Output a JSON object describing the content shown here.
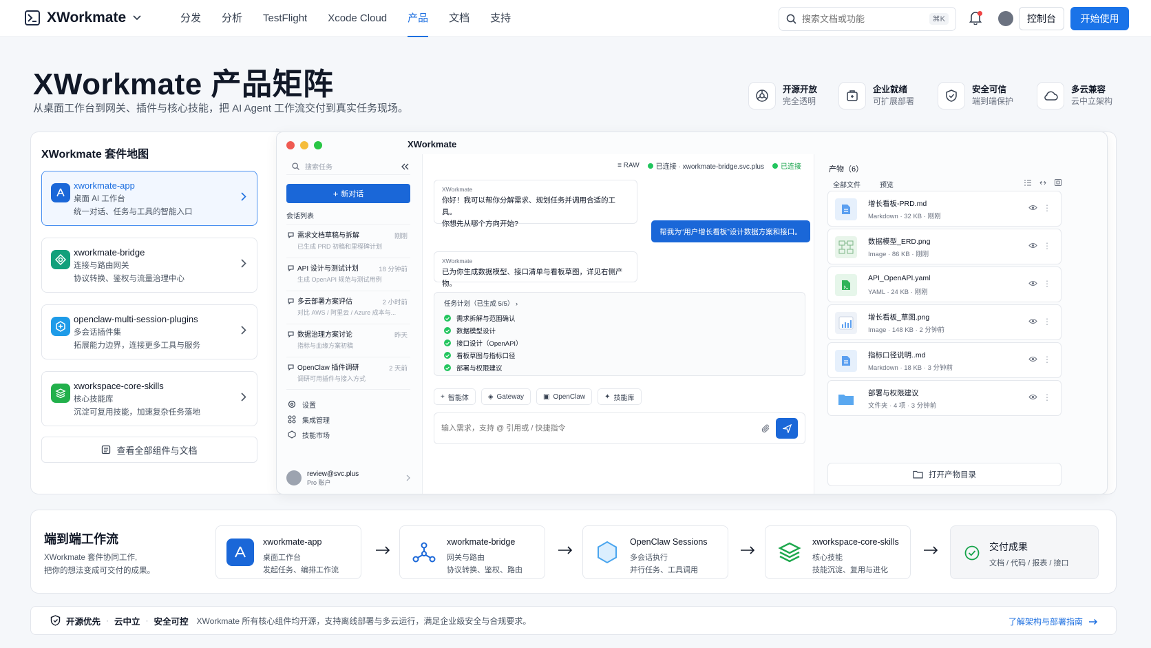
{
  "nav": {
    "brand": "XWorkmate",
    "links": [
      "分发",
      "分析",
      "TestFlight",
      "Xcode Cloud",
      "产品",
      "文档",
      "支持"
    ],
    "active_link": "产品",
    "search_placeholder": "搜索文档或功能",
    "search_kbd": "⌘K",
    "console_label": "控制台",
    "start_label": "开始使用"
  },
  "hero": {
    "title": "XWorkmate 产品矩阵",
    "subtitle": "从桌面工作台到网关、插件与核心技能，把 AI Agent 工作流交付到真实任务现场。",
    "features": [
      {
        "title": "开源开放",
        "desc": "完全透明",
        "icon": "open-source-icon"
      },
      {
        "title": "企业就绪",
        "desc": "可扩展部署",
        "icon": "enterprise-icon"
      },
      {
        "title": "安全可信",
        "desc": "端到端保护",
        "icon": "shield-icon"
      },
      {
        "title": "多云兼容",
        "desc": "云中立架构",
        "icon": "cloud-icon"
      }
    ]
  },
  "suite_map": {
    "title": "XWorkmate 套件地图",
    "components": [
      {
        "name": "xworkmate-app",
        "subtitle": "桌面 AI 工作台",
        "desc": "统一对话、任务与工具的智能入口",
        "color": "#1a67d8"
      },
      {
        "name": "xworkmate-bridge",
        "subtitle": "连接与路由网关",
        "desc": "协议转换、鉴权与流量治理中心",
        "color": "#12a07b"
      },
      {
        "name": "openclaw-multi-session-plugins",
        "subtitle": "多会话插件集",
        "desc": "拓展能力边界，连接更多工具与服务",
        "color": "#1e9be8"
      },
      {
        "name": "xworkspace-core-skills",
        "subtitle": "核心技能库",
        "desc": "沉淀可复用技能，加速复杂任务落地",
        "color": "#22b04b"
      }
    ],
    "all_button": "查看全部组件与文档"
  },
  "app_window": {
    "title": "XWorkmate",
    "sidebar": {
      "search_placeholder": "搜索任务",
      "new_chat": "新对话",
      "list_label": "会话列表",
      "conversations": [
        {
          "title": "需求文档草稿与拆解",
          "time": "刚刚",
          "desc": "已生成 PRD 初稿和里程碑计划"
        },
        {
          "title": "API 设计与测试计划",
          "time": "18 分钟前",
          "desc": "生成 OpenAPI 规范与测试用例"
        },
        {
          "title": "多云部署方案评估",
          "time": "2 小时前",
          "desc": "对比 AWS / 阿里云 / Azure 成本与..."
        },
        {
          "title": "数据治理方案讨论",
          "time": "昨天",
          "desc": "指标与血缘方案初稿"
        },
        {
          "title": "OpenClaw 插件调研",
          "time": "2 天前",
          "desc": "调研可用插件与接入方式"
        }
      ],
      "nav_items": [
        "设置",
        "集成管理",
        "技能市场"
      ],
      "account_email": "review@svc.plus",
      "account_plan": "Pro 账户"
    },
    "chat": {
      "raw_label": "RAW",
      "connection": "已连接 · xworkmate-bridge.svc.plus",
      "connected": "已连接",
      "msg1_sender": "XWorkmate",
      "msg1_line1": "你好！我可以帮你分解需求、规划任务并调用合适的工具。",
      "msg1_line2": "你想先从哪个方向开始?",
      "user_msg": "帮我为“用户增长看板”设计数据方案和接口。",
      "msg2_sender": "XWorkmate",
      "msg2_text": "已为你生成数据模型、接口清单与看板草图，详见右侧产物。",
      "plan_header": "任务计划（已生成 5/5）",
      "plan_items": [
        "需求拆解与范围确认",
        "数据模型设计",
        "接口设计（OpenAPI）",
        "看板草图与指标口径",
        "部署与权限建议"
      ],
      "chips": [
        "智能体",
        "Gateway",
        "OpenClaw",
        "技能库"
      ],
      "input_placeholder": "输入需求，支持 @ 引用或 / 快捷指令"
    },
    "artifacts": {
      "header": "产物（6）",
      "tabs": [
        "全部文件",
        "预览"
      ],
      "files": [
        {
          "name": "增长看板-PRD.md",
          "meta": "Markdown · 32 KB · 刚刚",
          "icon": "doc-file-icon"
        },
        {
          "name": "数据模型_ERD.png",
          "meta": "Image · 86 KB · 刚刚",
          "icon": "image-file-icon"
        },
        {
          "name": "API_OpenAPI.yaml",
          "meta": "YAML · 24 KB · 刚刚",
          "icon": "yaml-file-icon"
        },
        {
          "name": "增长看板_草图.png",
          "meta": "Image · 148 KB · 2 分钟前",
          "icon": "chart-file-icon"
        },
        {
          "name": "指标口径说明..md",
          "meta": "Markdown · 18 KB · 3 分钟前",
          "icon": "doc-file-icon"
        },
        {
          "name": "部署与权限建议",
          "meta": "文件夹 · 4 项 · 3 分钟前",
          "icon": "folder-icon"
        }
      ],
      "open_dir": "打开产物目录"
    }
  },
  "workflow": {
    "title": "端到端工作流",
    "desc_line1": "XWorkmate 套件协同工作,",
    "desc_line2": "把你的想法变成可交付的成果。",
    "steps": [
      {
        "name": "xworkmate-app",
        "subtitle": "桌面工作台",
        "desc": "发起任务、编排工作流"
      },
      {
        "name": "xworkmate-bridge",
        "subtitle": "网关与路由",
        "desc": "协议转换、鉴权、路由"
      },
      {
        "name": "OpenClaw Sessions",
        "subtitle": "多会话执行",
        "desc": "并行任务、工具调用"
      },
      {
        "name": "xworkspace-core-skills",
        "subtitle": "核心技能",
        "desc": "技能沉淀、复用与进化"
      }
    ],
    "deliver_title": "交付成果",
    "deliver_desc": "文档 / 代码 / 报表 / 接口"
  },
  "footer": {
    "tag1": "开源优先",
    "tag2": "云中立",
    "tag3": "安全可控",
    "desc": "XWorkmate 所有核心组件均开源，支持离线部署与多云运行，满足企业级安全与合规要求。",
    "link": "了解架构与部署指南"
  },
  "colors": {
    "accent": "#1a73e8",
    "success": "#22c55e"
  }
}
